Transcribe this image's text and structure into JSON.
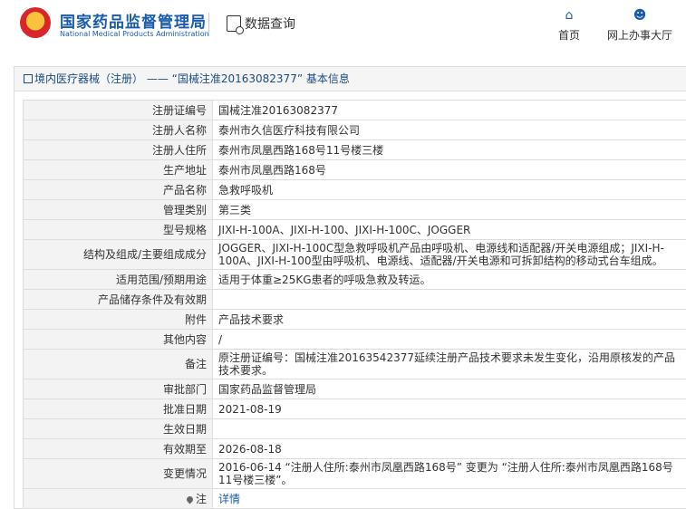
{
  "header": {
    "logo_title": "国家药品监督管理局",
    "logo_subtitle": "National Medical Products Administration",
    "query_label": "数据查询",
    "nav_home": "首页",
    "nav_hall": "网上办事大厅"
  },
  "breadcrumb": "境内医疗器械（注册） —— “国械注准20163082377” 基本信息",
  "rows": [
    {
      "label": "注册证编号",
      "value": "国械注准20163082377"
    },
    {
      "label": "注册人名称",
      "value": "泰州市久信医疗科技有限公司"
    },
    {
      "label": "注册人住所",
      "value": "泰州市凤凰西路168号11号楼三楼"
    },
    {
      "label": "生产地址",
      "value": "泰州市凤凰西路168号"
    },
    {
      "label": "产品名称",
      "value": "急救呼吸机"
    },
    {
      "label": "管理类别",
      "value": "第三类"
    },
    {
      "label": "型号规格",
      "value": "JIXI-H-100A、JIXI-H-100、JIXI-H-100C、JOGGER"
    },
    {
      "label": "结构及组成/主要组成成分",
      "value": "JOGGER、JIXI-H-100C型急救呼吸机产品由呼吸机、电源线和适配器/开关电源组成；JIXI-H-100A、JIXI-H-100型由呼吸机、电源线、适配器/开关电源和可拆卸结构的移动式台车组成。"
    },
    {
      "label": "适用范围/预期用途",
      "value": "适用于体重≥25KG患者的呼吸急救及转运。"
    },
    {
      "label": "产品储存条件及有效期",
      "value": ""
    },
    {
      "label": "附件",
      "value": "产品技术要求"
    },
    {
      "label": "其他内容",
      "value": "/"
    },
    {
      "label": "备注",
      "value": "原注册证编号：国械注准20163542377延续注册产品技术要求未发生变化，沿用原核发的产品技术要求。"
    },
    {
      "label": "审批部门",
      "value": "国家药品监督管理局"
    },
    {
      "label": "批准日期",
      "value": "2021-08-19"
    },
    {
      "label": "生效日期",
      "value": ""
    },
    {
      "label": "有效期至",
      "value": "2026-08-18"
    },
    {
      "label": "变更情况",
      "value": "2016-06-14 “注册人住所:泰州市凤凰西路168号” 变更为 “注册人住所:泰州市凤凰西路168号11号楼三楼”。"
    }
  ],
  "note_row": {
    "label": "注",
    "link": "详情"
  },
  "icons": {
    "home": "home-icon",
    "user": "user-icon",
    "query": "document-search-icon",
    "emblem": "national-emblem-icon"
  },
  "colors": {
    "brand": "#1a5cab",
    "label_bg": "#f3f3f3"
  }
}
